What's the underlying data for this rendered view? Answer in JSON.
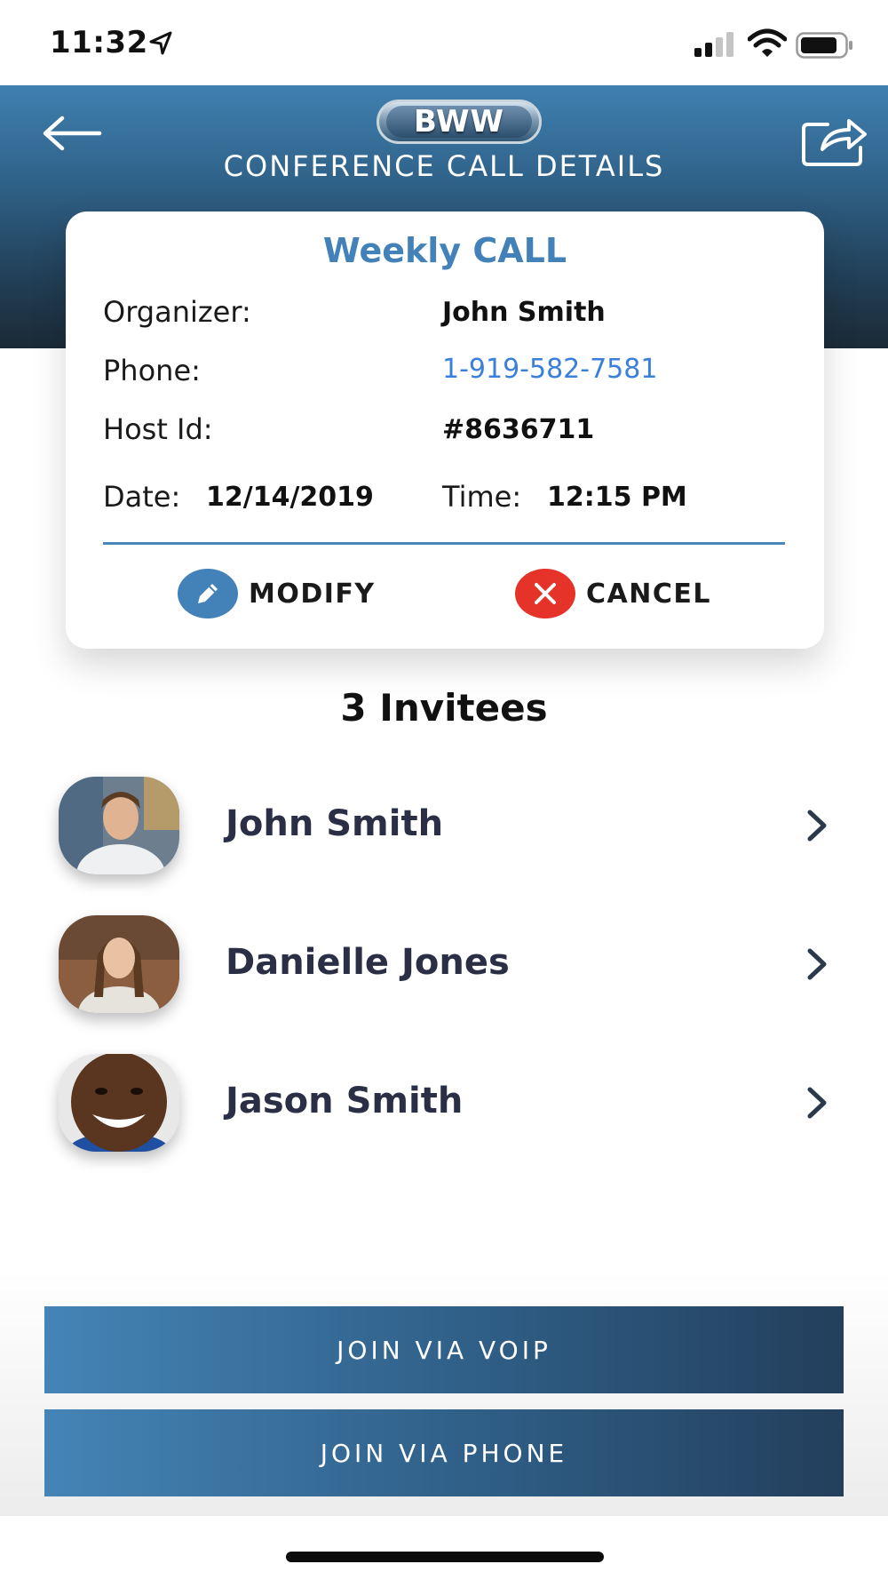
{
  "status_bar": {
    "time": "11:32"
  },
  "header": {
    "logo_text": "BWW",
    "title": "CONFERENCE CALL DETAILS"
  },
  "card": {
    "title": "Weekly CALL",
    "organizer_label": "Organizer:",
    "organizer_value": "John Smith",
    "phone_label": "Phone:",
    "phone_value": "1-919-582-7581",
    "host_label": "Host Id:",
    "host_value": "#8636711",
    "date_label": "Date:",
    "date_value": "12/14/2019",
    "time_label": "Time:",
    "time_value": "12:15 PM",
    "modify_label": "MODIFY",
    "cancel_label": "CANCEL"
  },
  "invitees": {
    "title": "3 Invitees",
    "items": [
      {
        "name": "John Smith"
      },
      {
        "name": "Danielle Jones"
      },
      {
        "name": "Jason Smith"
      }
    ]
  },
  "actions": {
    "join_voip": "JOIN VIA VOIP",
    "join_phone": "JOIN VIA PHONE"
  },
  "colors": {
    "accent": "#4282b8",
    "link": "#3a7fd9",
    "cancel_red": "#e5332a",
    "header_top": "#3f80b1",
    "header_bottom": "#1b2a36"
  }
}
